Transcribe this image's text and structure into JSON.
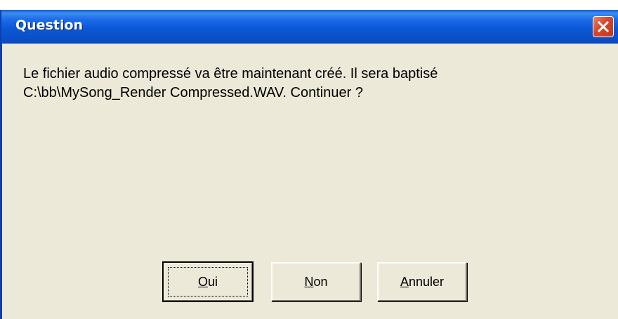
{
  "dialog": {
    "title": "Question",
    "message_lines": [
      "Le fichier audio compressé va être maintenant créé. Il sera baptisé",
      "C:\\bb\\MySong_Render Compressed.WAV. Continuer ?"
    ],
    "buttons": {
      "yes": {
        "mnemonic": "O",
        "rest": "ui"
      },
      "no": {
        "mnemonic": "N",
        "rest": "on"
      },
      "cancel": {
        "mnemonic": "A",
        "rest": "nnuler"
      }
    }
  },
  "icons": {
    "close": "close-icon"
  },
  "colors": {
    "titlebar": "#0a58d6",
    "body": "#ece9d8",
    "close_button": "#d5452a"
  }
}
